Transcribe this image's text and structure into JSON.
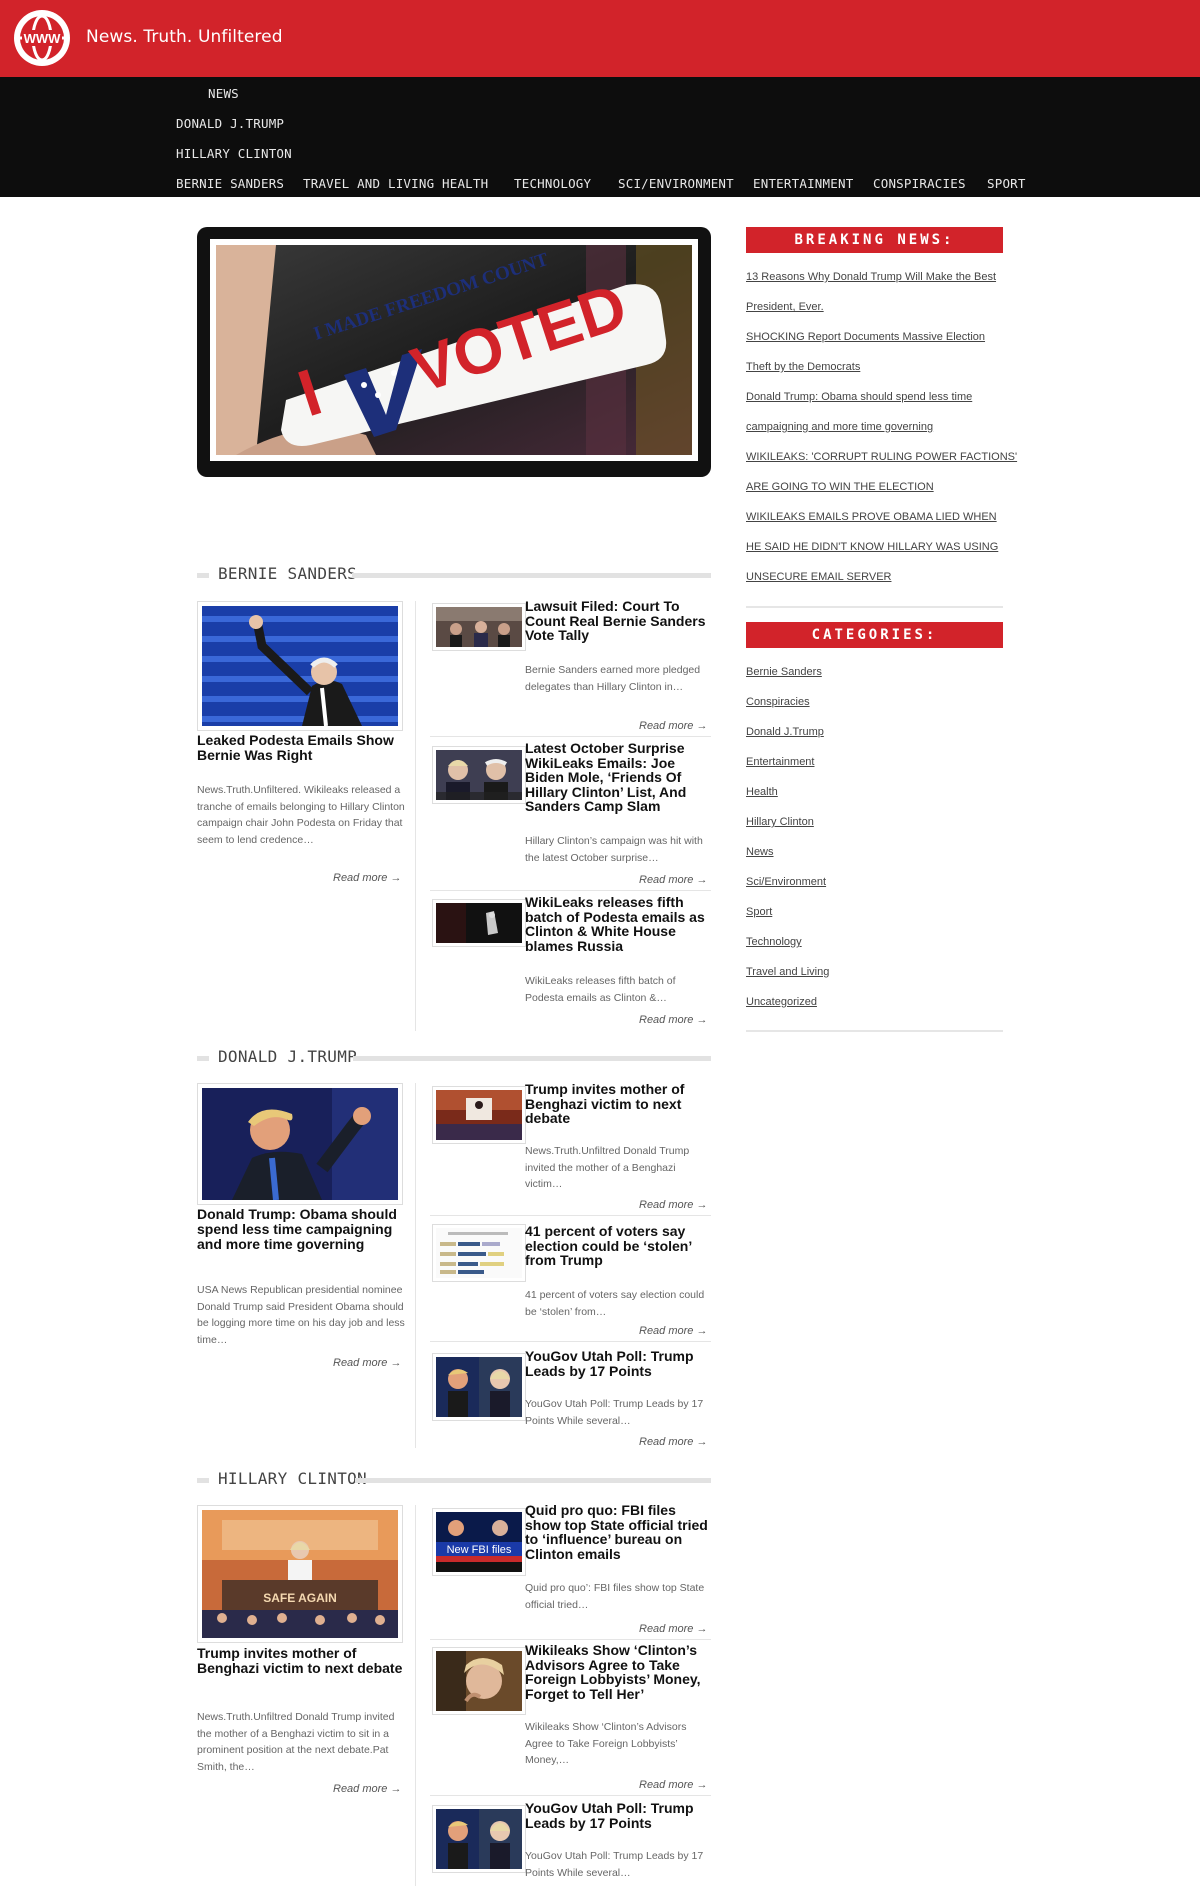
{
  "header": {
    "logo_text": "WWW",
    "site_title": "News. Truth. Unfiltered",
    "colors": {
      "brand_red": "#d2232a",
      "nav_black": "#0d0d0d"
    }
  },
  "nav": {
    "items": [
      "NEWS",
      "DONALD J.TRUMP",
      "HILLARY CLINTON",
      "BERNIE SANDERS",
      "TRAVEL AND LIVING",
      "HEALTH",
      "TECHNOLOGY",
      "SCI/ENVIRONMENT",
      "ENTERTAINMENT",
      "CONSPIRACIES",
      "SPORT"
    ]
  },
  "hero": {
    "sticker_line1": "I MADE FREEDOM COUNT",
    "sticker_i": "I",
    "sticker_voted": "VOTED"
  },
  "read_more": "Read more →",
  "sections": [
    {
      "title": "BERNIE SANDERS",
      "featured": {
        "title": "Leaked Podesta Emails Show Bernie Was Right",
        "excerpt": "News.Truth.Unfiltered. Wikileaks released a tranche of emails belonging to Hillary Clinton campaign chair John Podesta on Friday that seem to lend credence…"
      },
      "items": [
        {
          "title": "Lawsuit Filed: Court To Count Real Bernie Sanders Vote Tally",
          "excerpt": "Bernie Sanders earned more pledged delegates than Hillary Clinton in…"
        },
        {
          "title": "Latest October Surprise WikiLeaks Emails: Joe Biden Mole, ‘Friends Of Hillary Clinton’ List, And Sanders Camp Slam",
          "excerpt": "Hillary Clinton’s campaign was hit with the latest October surprise…"
        },
        {
          "title": "WikiLeaks releases fifth batch of Podesta emails as Clinton & White House blames Russia",
          "excerpt": "WikiLeaks releases fifth batch of Podesta emails as Clinton &…"
        }
      ]
    },
    {
      "title": "DONALD J.TRUMP",
      "featured": {
        "title": "Donald Trump: Obama should spend less time campaigning and more time governing",
        "excerpt": "USA News Republican presidential nominee Donald Trump said President Obama should be logging more time on his day job and less time…"
      },
      "items": [
        {
          "title": "Trump invites mother of Benghazi victim to next debate",
          "excerpt": "News.Truth.Unfiltred Donald Trump invited the mother of a Benghazi victim…"
        },
        {
          "title": "41 percent of voters say election could be ‘stolen’ from Trump",
          "excerpt": "41 percent of voters say election could be ‘stolen’ from…"
        },
        {
          "title": "YouGov Utah Poll: Trump Leads by 17 Points",
          "excerpt": "YouGov Utah Poll: Trump Leads by 17 Points While several…"
        }
      ]
    },
    {
      "title": "HILLARY CLINTON",
      "featured": {
        "title": "Trump invites mother of Benghazi victim to next debate",
        "excerpt": "News.Truth.Unfiltred Donald Trump invited the mother of a Benghazi victim to sit in a prominent position at the next debate.Pat Smith, the…",
        "image_text": "SAFE AGAIN"
      },
      "items": [
        {
          "title": "Quid pro quo: FBI files show top State official tried to ‘influence’ bureau on Clinton emails",
          "excerpt": "Quid pro quo’: FBI files show top State official tried…",
          "image_text": "New FBI files"
        },
        {
          "title": "Wikileaks Show ‘Clinton’s Advisors Agree to Take Foreign Lobbyists’ Money, Forget to Tell Her’",
          "excerpt": "Wikileaks Show ‘Clinton’s Advisors Agree to Take Foreign Lobbyists’ Money,…"
        },
        {
          "title": "YouGov Utah Poll: Trump Leads by 17 Points",
          "excerpt": "YouGov Utah Poll: Trump Leads by 17 Points While several…"
        }
      ]
    }
  ],
  "sidebar": {
    "breaking_title": "BREAKING NEWS:",
    "breaking_lines": [
      "13 Reasons Why Donald Trump Will Make the Best",
      "President, Ever.",
      "SHOCKING Report Documents Massive Election",
      "Theft by the Democrats",
      "Donald Trump: Obama should spend less time",
      "campaigning and more time governing",
      "WIKILEAKS: 'CORRUPT RULING POWER FACTIONS'",
      "ARE GOING TO WIN THE ELECTION",
      "WIKILEAKS EMAILS PROVE OBAMA LIED WHEN",
      "HE SAID HE DIDN'T KNOW HILLARY WAS USING",
      "UNSECURE EMAIL SERVER"
    ],
    "categories_title": "CATEGORIES:",
    "categories": [
      "Bernie Sanders",
      "Conspiracies",
      "Donald J.Trump",
      "Entertainment",
      "Health",
      "Hillary Clinton",
      "News",
      "Sci/Environment",
      "Sport",
      "Technology",
      "Travel and Living",
      "Uncategorized"
    ]
  }
}
